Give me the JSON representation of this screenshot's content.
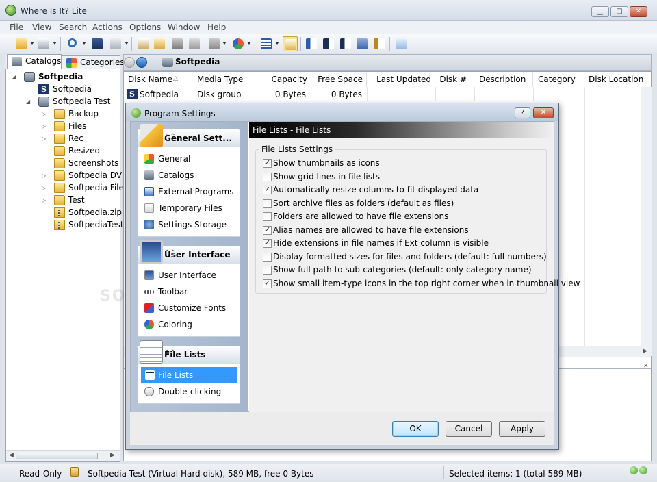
{
  "window": {
    "title": "Where Is It? Lite",
    "minimize": "▁",
    "maximize": "□",
    "close": "✕"
  },
  "menu": [
    "File",
    "View",
    "Search",
    "Actions",
    "Options",
    "Window",
    "Help"
  ],
  "toolbar_icons": [
    "open-folder-icon",
    "print-icon",
    "search-icon",
    "save-icon",
    "clipboard-icon",
    "new-catalog-icon",
    "scan-disk-icon",
    "eject-icon",
    "edit-icon",
    "tools-icon",
    "colors-icon",
    "details-view-icon",
    "folder-view-icon",
    "sort-az-icon",
    "sort-save-icon",
    "sort-size-icon",
    "sort-disk-icon",
    "sort-za-icon",
    "whats-this-icon"
  ],
  "left_tabs": [
    {
      "label": "Catalogs"
    },
    {
      "label": "Categories"
    }
  ],
  "tree": [
    {
      "label": "Softpedia",
      "icon": "catalog-icon",
      "bold": true
    },
    {
      "label": "Softpedia",
      "icon": "softpedia-icon"
    },
    {
      "label": "Softpedia Test",
      "icon": "hard-disk-icon"
    },
    {
      "label": "Backup",
      "icon": "folder-icon"
    },
    {
      "label": "Files",
      "icon": "folder-icon"
    },
    {
      "label": "Rec",
      "icon": "folder-icon"
    },
    {
      "label": "Resized",
      "icon": "folder-icon"
    },
    {
      "label": "Screenshots",
      "icon": "folder-icon"
    },
    {
      "label": "Softpedia DVD",
      "icon": "folder-icon"
    },
    {
      "label": "Softpedia Files",
      "icon": "folder-icon"
    },
    {
      "label": "Test",
      "icon": "folder-icon"
    },
    {
      "label": "Softpedia.zip",
      "icon": "zip-icon"
    },
    {
      "label": "SoftpediaTest",
      "icon": "zip-icon"
    }
  ],
  "breadcrumb": "Softpedia",
  "columns": [
    "Disk Name",
    "Media Type",
    "Capacity",
    "Free Space",
    "Last Updated",
    "Disk #",
    "Description",
    "Category",
    "Disk Location"
  ],
  "rows": [
    {
      "disk_name": "Softpedia",
      "media_type": "Disk group",
      "capacity": "0 Bytes",
      "free_space": "0 Bytes"
    }
  ],
  "status": {
    "mode": "Read-Only",
    "info": "Softpedia Test (Virtual Hard disk), 589 MB, free 0 Bytes",
    "selected": "Selected items: 1 (total 589 MB)"
  },
  "dialog": {
    "title": "Program Settings",
    "help": "?",
    "close": "✕",
    "groups": [
      {
        "title": "General Sett...",
        "items": [
          "General",
          "Catalogs",
          "External Programs",
          "Temporary Files",
          "Settings Storage"
        ]
      },
      {
        "title": "User Interface",
        "items": [
          "User Interface",
          "Toolbar",
          "Customize Fonts",
          "Coloring"
        ]
      },
      {
        "title": "File Lists",
        "items": [
          "File Lists",
          "Double-clicking"
        ]
      }
    ],
    "selected_item": "File Lists",
    "section_header": "File Lists - File Lists",
    "fieldset_legend": "File Lists Settings",
    "options": [
      {
        "label": "Show thumbnails as icons",
        "checked": true
      },
      {
        "label": "Show grid lines in file lists",
        "checked": false
      },
      {
        "label": "Automatically resize columns to fit displayed data",
        "checked": true
      },
      {
        "label": "Sort archive files as folders (default as files)",
        "checked": false
      },
      {
        "label": "Folders are allowed to have file extensions",
        "checked": false
      },
      {
        "label": "Alias names are allowed to have file extensions",
        "checked": true
      },
      {
        "label": "Hide extensions in file names if Ext column is visible",
        "checked": true
      },
      {
        "label": "Display formatted sizes for files and folders (default: full numbers)",
        "checked": false
      },
      {
        "label": "Show full path to sub-categories (default: only category name)",
        "checked": false
      },
      {
        "label": "Show small item-type icons in the top right corner when in thumbnail view",
        "checked": true
      }
    ],
    "buttons": {
      "ok": "OK",
      "cancel": "Cancel",
      "apply": "Apply"
    }
  },
  "watermark": "SOFTPEDIA"
}
